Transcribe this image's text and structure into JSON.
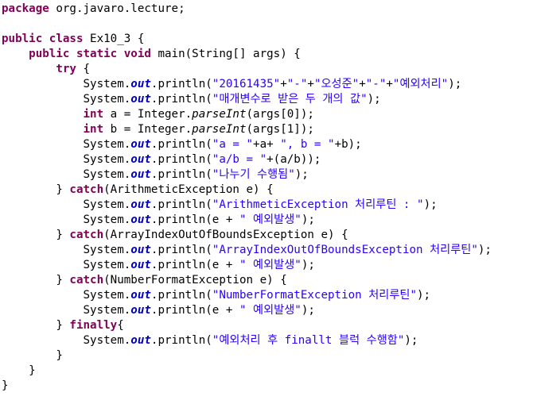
{
  "editor": {
    "lines": [
      [
        [
          "kw",
          "package"
        ],
        [
          "pl",
          " org.javaro.lecture;"
        ]
      ],
      [],
      [
        [
          "kw",
          "public"
        ],
        [
          "pl",
          " "
        ],
        [
          "kw",
          "class"
        ],
        [
          "pl",
          " Ex10_3 {"
        ]
      ],
      [
        [
          "pl",
          "    "
        ],
        [
          "kw",
          "public"
        ],
        [
          "pl",
          " "
        ],
        [
          "kw",
          "static"
        ],
        [
          "pl",
          " "
        ],
        [
          "kw",
          "void"
        ],
        [
          "pl",
          " main(String[] args) {"
        ]
      ],
      [
        [
          "pl",
          "        "
        ],
        [
          "kw",
          "try"
        ],
        [
          "pl",
          " {"
        ]
      ],
      [
        [
          "pl",
          "            System."
        ],
        [
          "fi",
          "out"
        ],
        [
          "pl",
          ".println("
        ],
        [
          "st",
          "\"20161435\""
        ],
        [
          "pl",
          "+"
        ],
        [
          "st",
          "\"-\""
        ],
        [
          "pl",
          "+"
        ],
        [
          "st",
          "\"오성준\""
        ],
        [
          "pl",
          "+"
        ],
        [
          "st",
          "\"-\""
        ],
        [
          "pl",
          "+"
        ],
        [
          "st",
          "\"예외처리\""
        ],
        [
          "pl",
          ");"
        ]
      ],
      [
        [
          "pl",
          "            System."
        ],
        [
          "fi",
          "out"
        ],
        [
          "pl",
          ".println("
        ],
        [
          "st",
          "\"매개변수로 받은 두 개의 값\""
        ],
        [
          "pl",
          ");"
        ]
      ],
      [
        [
          "pl",
          "            "
        ],
        [
          "kw",
          "int"
        ],
        [
          "pl",
          " a = Integer."
        ],
        [
          "sm",
          "parseInt"
        ],
        [
          "pl",
          "(args[0]);"
        ]
      ],
      [
        [
          "pl",
          "            "
        ],
        [
          "kw",
          "int"
        ],
        [
          "pl",
          " b = Integer."
        ],
        [
          "sm",
          "parseInt"
        ],
        [
          "pl",
          "(args[1]);"
        ]
      ],
      [
        [
          "pl",
          "            System."
        ],
        [
          "fi",
          "out"
        ],
        [
          "pl",
          ".println("
        ],
        [
          "st",
          "\"a = \""
        ],
        [
          "pl",
          "+a+ "
        ],
        [
          "st",
          "\", b = \""
        ],
        [
          "pl",
          "+b);"
        ]
      ],
      [
        [
          "pl",
          "            System."
        ],
        [
          "fi",
          "out"
        ],
        [
          "pl",
          ".println("
        ],
        [
          "st",
          "\"a/b = \""
        ],
        [
          "pl",
          "+(a/b));"
        ]
      ],
      [
        [
          "pl",
          "            System."
        ],
        [
          "fi",
          "out"
        ],
        [
          "pl",
          ".println("
        ],
        [
          "st",
          "\"나누기 수행됨\""
        ],
        [
          "pl",
          ");"
        ]
      ],
      [
        [
          "pl",
          "        } "
        ],
        [
          "kw",
          "catch"
        ],
        [
          "pl",
          "(ArithmeticException e) {"
        ]
      ],
      [
        [
          "pl",
          "            System."
        ],
        [
          "fi",
          "out"
        ],
        [
          "pl",
          ".println("
        ],
        [
          "st",
          "\"ArithmeticException 처리루틴 : \""
        ],
        [
          "pl",
          ");"
        ]
      ],
      [
        [
          "pl",
          "            System."
        ],
        [
          "fi",
          "out"
        ],
        [
          "pl",
          ".println(e + "
        ],
        [
          "st",
          "\" 예외발생\""
        ],
        [
          "pl",
          ");"
        ]
      ],
      [
        [
          "pl",
          "        } "
        ],
        [
          "kw",
          "catch"
        ],
        [
          "pl",
          "(ArrayIndexOutOfBoundsException e) {"
        ]
      ],
      [
        [
          "pl",
          "            System."
        ],
        [
          "fi",
          "out"
        ],
        [
          "pl",
          ".println("
        ],
        [
          "st",
          "\"ArrayIndexOutOfBoundsException 처리루틴\""
        ],
        [
          "pl",
          ");"
        ]
      ],
      [
        [
          "pl",
          "            System."
        ],
        [
          "fi",
          "out"
        ],
        [
          "pl",
          ".println(e + "
        ],
        [
          "st",
          "\" 예외발생\""
        ],
        [
          "pl",
          ");"
        ]
      ],
      [
        [
          "pl",
          "        } "
        ],
        [
          "kw",
          "catch"
        ],
        [
          "pl",
          "(NumberFormatException e) {"
        ]
      ],
      [
        [
          "pl",
          "            System."
        ],
        [
          "fi",
          "out"
        ],
        [
          "pl",
          ".println("
        ],
        [
          "st",
          "\"NumberFormatException 처리루틴\""
        ],
        [
          "pl",
          ");"
        ]
      ],
      [
        [
          "pl",
          "            System."
        ],
        [
          "fi",
          "out"
        ],
        [
          "pl",
          ".println(e + "
        ],
        [
          "st",
          "\" 예외발생\""
        ],
        [
          "pl",
          ");"
        ]
      ],
      [
        [
          "pl",
          "        } "
        ],
        [
          "kw",
          "finally"
        ],
        [
          "pl",
          "{"
        ]
      ],
      [
        [
          "pl",
          "            System."
        ],
        [
          "fi",
          "out"
        ],
        [
          "pl",
          ".println("
        ],
        [
          "st",
          "\"예외처리 후 finallt 블럭 수행함\""
        ],
        [
          "pl",
          ");"
        ]
      ],
      [
        [
          "pl",
          "        }"
        ]
      ],
      [
        [
          "pl",
          "    }"
        ]
      ],
      [
        [
          "pl",
          "}"
        ]
      ]
    ]
  }
}
